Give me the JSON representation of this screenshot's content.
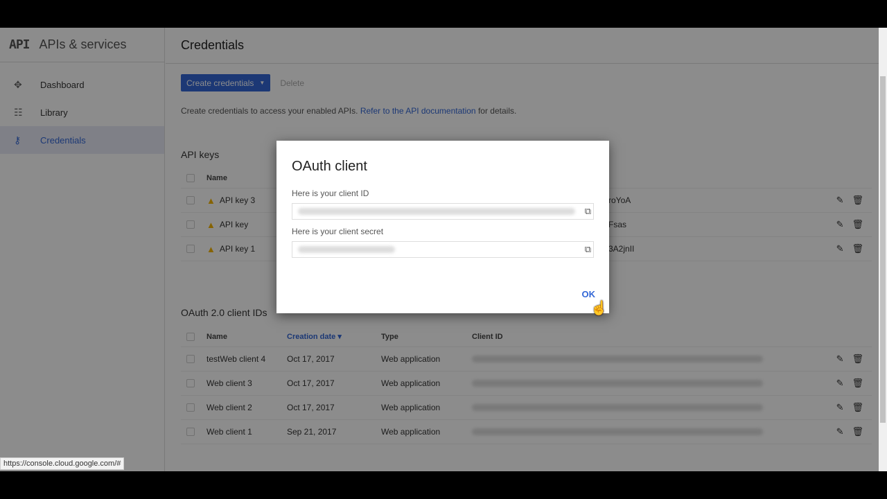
{
  "sidebar": {
    "logo": "API",
    "title": "APIs & services",
    "items": [
      {
        "label": "Dashboard",
        "icon": "dashboard-icon"
      },
      {
        "label": "Library",
        "icon": "library-icon"
      },
      {
        "label": "Credentials",
        "icon": "key-icon",
        "selected": true
      }
    ]
  },
  "header": {
    "title": "Credentials"
  },
  "toolbar": {
    "create_label": "Create credentials",
    "delete_label": "Delete"
  },
  "info": {
    "prefix": "Create credentials to access your enabled APIs.",
    "link": "Refer to the API documentation",
    "suffix": "for details."
  },
  "api_keys": {
    "title": "API keys",
    "header_name": "Name",
    "rows": [
      {
        "name": "API key 3",
        "key_tail": "roYoA"
      },
      {
        "name": "API key",
        "key_tail": "Fsas"
      },
      {
        "name": "API key 1",
        "key_tail": "3A2jnII"
      }
    ]
  },
  "oauth": {
    "title": "OAuth 2.0 client IDs",
    "headers": {
      "name": "Name",
      "date": "Creation date",
      "type": "Type",
      "client_id": "Client ID"
    },
    "rows": [
      {
        "name": "testWeb client 4",
        "date": "Oct 17, 2017",
        "type": "Web application"
      },
      {
        "name": "Web client 3",
        "date": "Oct 17, 2017",
        "type": "Web application"
      },
      {
        "name": "Web client 2",
        "date": "Oct 17, 2017",
        "type": "Web application"
      },
      {
        "name": "Web client 1",
        "date": "Sep 21, 2017",
        "type": "Web application"
      }
    ]
  },
  "dialog": {
    "title": "OAuth client",
    "client_id_label": "Here is your client ID",
    "client_secret_label": "Here is your client secret",
    "ok_label": "OK"
  },
  "status_url": "https://console.cloud.google.com/#",
  "colors": {
    "accent": "#3367d6",
    "warning": "#f4b400"
  }
}
